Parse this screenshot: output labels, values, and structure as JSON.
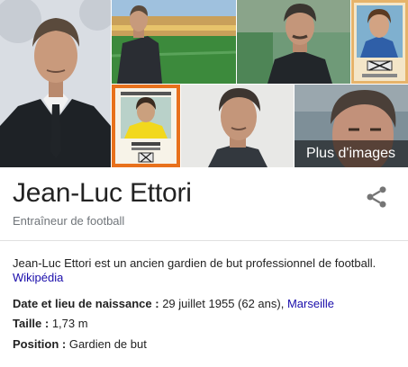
{
  "gallery": {
    "more_images_label": "Plus d'images",
    "images": [
      {
        "name": "portrait-suit"
      },
      {
        "name": "stadium-photo"
      },
      {
        "name": "training-pitch-photo"
      },
      {
        "name": "player-card-retro"
      },
      {
        "name": "sticker-card"
      },
      {
        "name": "profile-close"
      },
      {
        "name": "closeup-outdoor"
      }
    ]
  },
  "entity": {
    "title": "Jean-Luc Ettori",
    "subtitle": "Entraîneur de football"
  },
  "description": {
    "text": "Jean-Luc Ettori est un ancien gardien de but professionnel de football.",
    "source_link": "Wikipédia"
  },
  "facts": {
    "birth": {
      "label": "Date et lieu de naissance :",
      "value": " 29 juillet 1955 (62 ans), ",
      "link": "Marseille"
    },
    "height": {
      "label": "Taille :",
      "value": " 1,73 m"
    },
    "position": {
      "label": "Position :",
      "value": " Gardien de but"
    }
  },
  "icons": {
    "share": "share-icon"
  },
  "colors": {
    "link": "#1a0dab",
    "subtitle": "#70757a",
    "sticker_border": "#e8711c"
  }
}
